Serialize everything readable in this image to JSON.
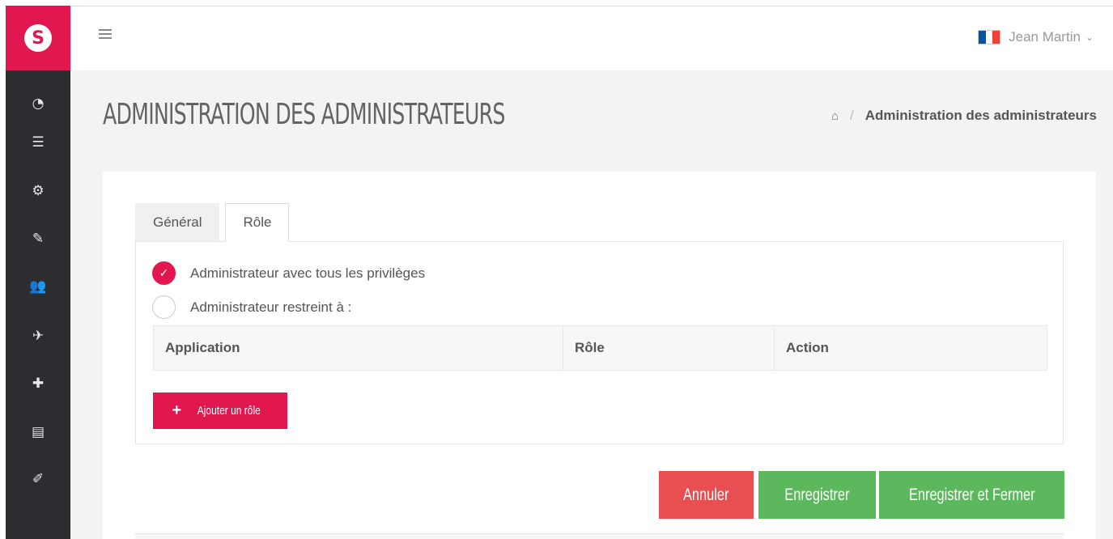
{
  "logo": {
    "letter": "S",
    "icon": "brand-s-logo"
  },
  "sidebar": {
    "items": [
      {
        "icon": "dashboard-icon",
        "glyph": "◔"
      },
      {
        "icon": "list-icon",
        "glyph": "☰"
      },
      {
        "icon": "cogs-icon",
        "glyph": "⚙"
      },
      {
        "icon": "edit-icon",
        "glyph": "✎"
      },
      {
        "icon": "users-icon",
        "glyph": "👥"
      },
      {
        "icon": "paper-plane-icon",
        "glyph": "✈"
      },
      {
        "icon": "puzzle-icon",
        "glyph": "✚"
      },
      {
        "icon": "window-icon",
        "glyph": "▤"
      },
      {
        "icon": "brush-icon",
        "glyph": "✐"
      }
    ]
  },
  "header": {
    "user_name": "Jean Martin",
    "chevron": "⌄",
    "flag_colors": [
      "#0055a4",
      "#ffffff",
      "#ef4135"
    ]
  },
  "page": {
    "title": "ADMINISTRATION DES ADMINISTRATEURS",
    "breadcrumb_home_glyph": "⌂",
    "breadcrumb_sep": "/",
    "breadcrumb_current": "Administration des administrateurs"
  },
  "tabs": [
    {
      "label": "Général",
      "active": false
    },
    {
      "label": "Rôle",
      "active": true
    }
  ],
  "role_panel": {
    "option_full": "Administrateur avec tous les privilèges",
    "option_restricted": "Administrateur restreint à :",
    "selected": "full",
    "table_headers": [
      "Application",
      "Rôle",
      "Action"
    ],
    "add_button_label": "Ajouter un rôle",
    "add_button_glyph": "+"
  },
  "actions": {
    "cancel": "Annuler",
    "save": "Enregistrer",
    "save_close": "Enregistrer et Fermer"
  },
  "colors": {
    "accent": "#e1184f",
    "sidebar_bg": "#2b2d30",
    "success": "#5cb85c",
    "danger": "#e84f51"
  }
}
